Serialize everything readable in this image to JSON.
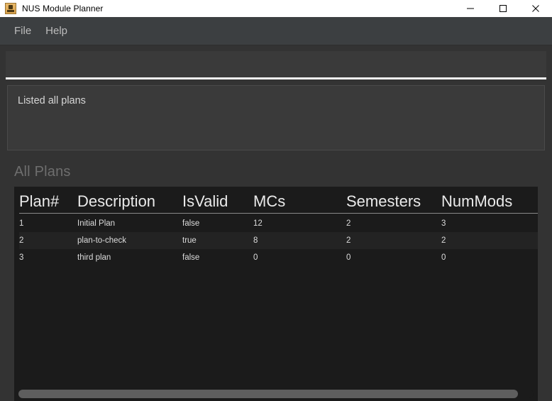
{
  "window": {
    "title": "NUS Module Planner",
    "icon": "app-icon",
    "controls": {
      "minimize": "minimize-icon",
      "maximize": "maximize-icon",
      "close": "close-icon"
    }
  },
  "menubar": {
    "items": [
      {
        "label": "File"
      },
      {
        "label": "Help"
      }
    ]
  },
  "command": {
    "value": "",
    "placeholder": ""
  },
  "result": {
    "text": "Listed all plans"
  },
  "plans_section": {
    "title": "All Plans",
    "columns": [
      {
        "key": "plan",
        "label": "Plan#"
      },
      {
        "key": "description",
        "label": "Description"
      },
      {
        "key": "isvalid",
        "label": "IsValid"
      },
      {
        "key": "mcs",
        "label": "MCs"
      },
      {
        "key": "semesters",
        "label": "Semesters"
      },
      {
        "key": "nummods",
        "label": "NumMods"
      }
    ],
    "rows": [
      {
        "plan": "1",
        "description": "Initial Plan",
        "isvalid": "false",
        "mcs": "12",
        "semesters": "2",
        "nummods": "3"
      },
      {
        "plan": "2",
        "description": "plan-to-check",
        "isvalid": "true",
        "mcs": "8",
        "semesters": "2",
        "nummods": "2"
      },
      {
        "plan": "3",
        "description": "third plan",
        "isvalid": "false",
        "mcs": "0",
        "semesters": "0",
        "nummods": "0"
      }
    ]
  },
  "scrollbar": {
    "orientation": "horizontal",
    "thumb_width_percent": 97
  },
  "colors": {
    "window_bg": "#333333",
    "menubar_bg": "#3c3f41",
    "panel_bg": "#3a3a3a",
    "table_bg": "#1b1b1b",
    "table_alt_row_bg": "#232323",
    "text_primary": "#e8e8e8",
    "text_muted": "#6e6e6e",
    "field_underline": "#f2f2f2",
    "titlebar_bg": "#ffffff"
  }
}
